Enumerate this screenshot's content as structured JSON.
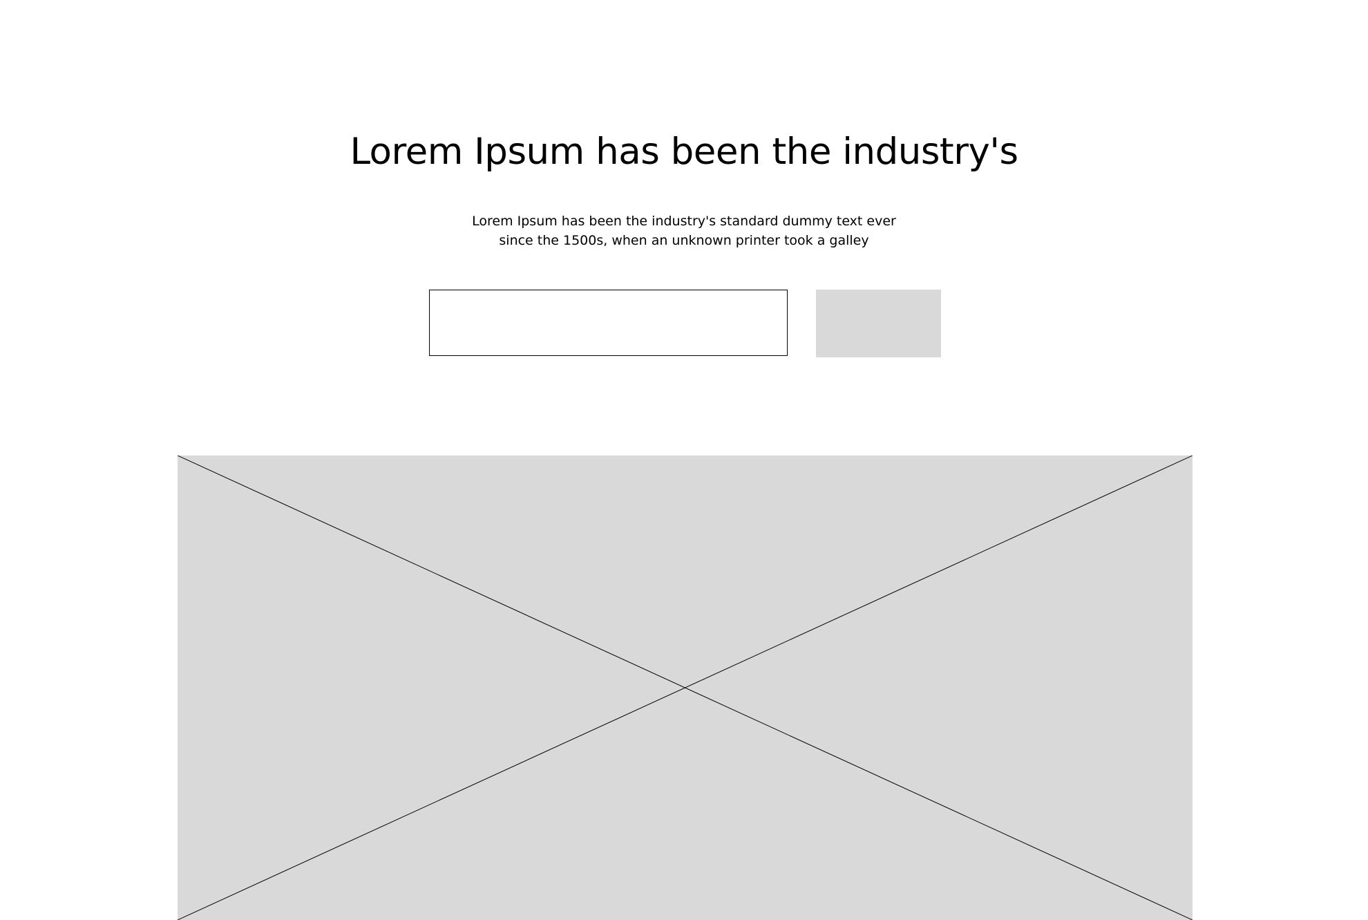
{
  "hero": {
    "title": "Lorem Ipsum has been the industry's",
    "description_lines": [
      "Lorem Ipsum has been the industry's standard dummy text ever",
      "since the 1500s, when an unknown printer took a galley"
    ]
  },
  "form": {
    "input_value": "",
    "input_placeholder": "",
    "button_label": ""
  },
  "colors": {
    "background": "#ffffff",
    "placeholder_fill": "#d9d9d9",
    "border": "#000000"
  },
  "icons": {
    "image_placeholder": "image-placeholder-icon"
  }
}
